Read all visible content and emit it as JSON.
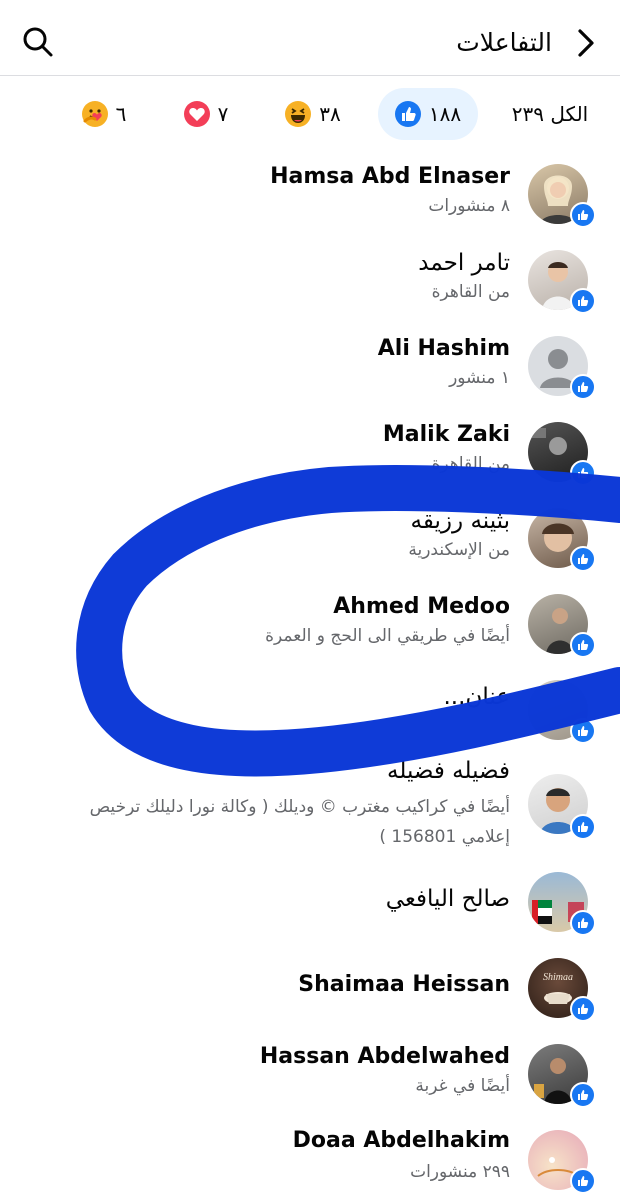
{
  "header": {
    "title": "التفاعلات"
  },
  "tabs": [
    {
      "label": "الكل ٢٣٩",
      "kind": "all"
    },
    {
      "label": "١٨٨",
      "kind": "like",
      "icon": "like-icon",
      "color": "#1877f2"
    },
    {
      "label": "٣٨",
      "kind": "haha",
      "icon": "haha-icon",
      "color": "#f7b125"
    },
    {
      "label": "٧",
      "kind": "love",
      "icon": "love-icon",
      "color": "#f33e58"
    },
    {
      "label": "٦",
      "kind": "care",
      "icon": "care-icon",
      "color": "#f7b125"
    }
  ],
  "people": [
    {
      "name": "Hamsa Abd Elnaser",
      "subtitle": "٨ منشورات"
    },
    {
      "name": "تامر احمد",
      "subtitle": "من القاهرة"
    },
    {
      "name": "Ali Hashim",
      "subtitle": "١ منشور"
    },
    {
      "name": "Malik Zaki",
      "subtitle": "من القاهرة"
    },
    {
      "name": "بثينه رزيقه",
      "subtitle": "من الإسكندرية"
    },
    {
      "name": "Ahmed Medoo",
      "subtitle": "أيضًا في طريقي الى الحج و العمرة"
    },
    {
      "name": "...عنان",
      "subtitle": ""
    },
    {
      "name": "فضيله فضيله",
      "subtitle": "أيضًا في كراكيب مغترب © وديلك ( وكالة نورا دليلك ترخيص إعلامي 156801 )"
    },
    {
      "name": "صالح اليافعي",
      "subtitle": ""
    },
    {
      "name": "Shaimaa Heissan",
      "subtitle": "",
      "avatar_text": "Shimaa"
    },
    {
      "name": "Hassan Abdelwahed",
      "subtitle": "أيضًا في غربة"
    },
    {
      "name": "Doaa Abdelhakim",
      "subtitle": "٢٩٩ منشورات"
    }
  ],
  "colors": {
    "accent": "#1877f2",
    "active_tab_bg": "#e7f3ff",
    "secondary_text": "#65676b",
    "scribble": "#0a37d6"
  }
}
